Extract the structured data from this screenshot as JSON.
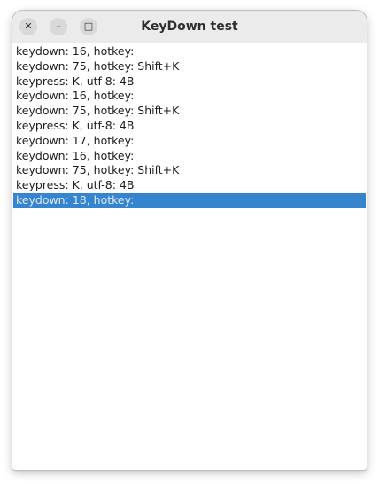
{
  "window": {
    "title": "KeyDown test",
    "controls": {
      "close_glyph": "✕",
      "minimize_glyph": "–",
      "maximize_glyph": "□"
    }
  },
  "log": {
    "items": [
      "keydown: 16, hotkey:",
      "keydown: 75, hotkey: Shift+K",
      "keypress: K, utf-8: 4B",
      "keydown: 16, hotkey:",
      "keydown: 75, hotkey: Shift+K",
      "keypress: K, utf-8: 4B",
      "keydown: 17, hotkey:",
      "keydown: 16, hotkey:",
      "keydown: 75, hotkey: Shift+K",
      "keypress: K, utf-8: 4B",
      "keydown: 18, hotkey:"
    ],
    "selected_index": 10
  },
  "colors": {
    "selection": "#3584d0",
    "titlebar": "#ebebeb"
  }
}
